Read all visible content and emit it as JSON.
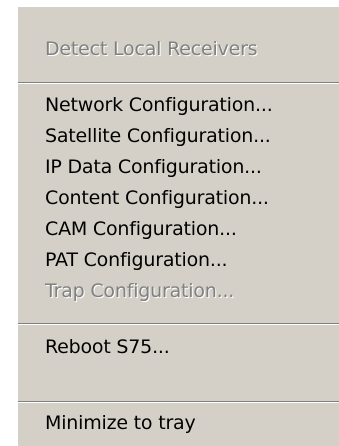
{
  "menu": {
    "items": [
      {
        "label": "Detect Local Receivers",
        "enabled": false
      },
      {
        "label": "Network Configuration...",
        "enabled": true
      },
      {
        "label": "Satellite Configuration...",
        "enabled": true
      },
      {
        "label": "IP Data Configuration...",
        "enabled": true
      },
      {
        "label": "Content Configuration...",
        "enabled": true
      },
      {
        "label": "CAM Configuration...",
        "enabled": true
      },
      {
        "label": "PAT Configuration...",
        "enabled": true
      },
      {
        "label": "Trap Configuration...",
        "enabled": false
      },
      {
        "label": "Reboot S75...",
        "enabled": true
      },
      {
        "label": "Minimize to tray",
        "enabled": true
      }
    ]
  },
  "colors": {
    "menu_background": "#d4d0c8",
    "disabled_text": "#808080",
    "separator_shadow": "#808080",
    "separator_highlight": "#ffffff"
  }
}
